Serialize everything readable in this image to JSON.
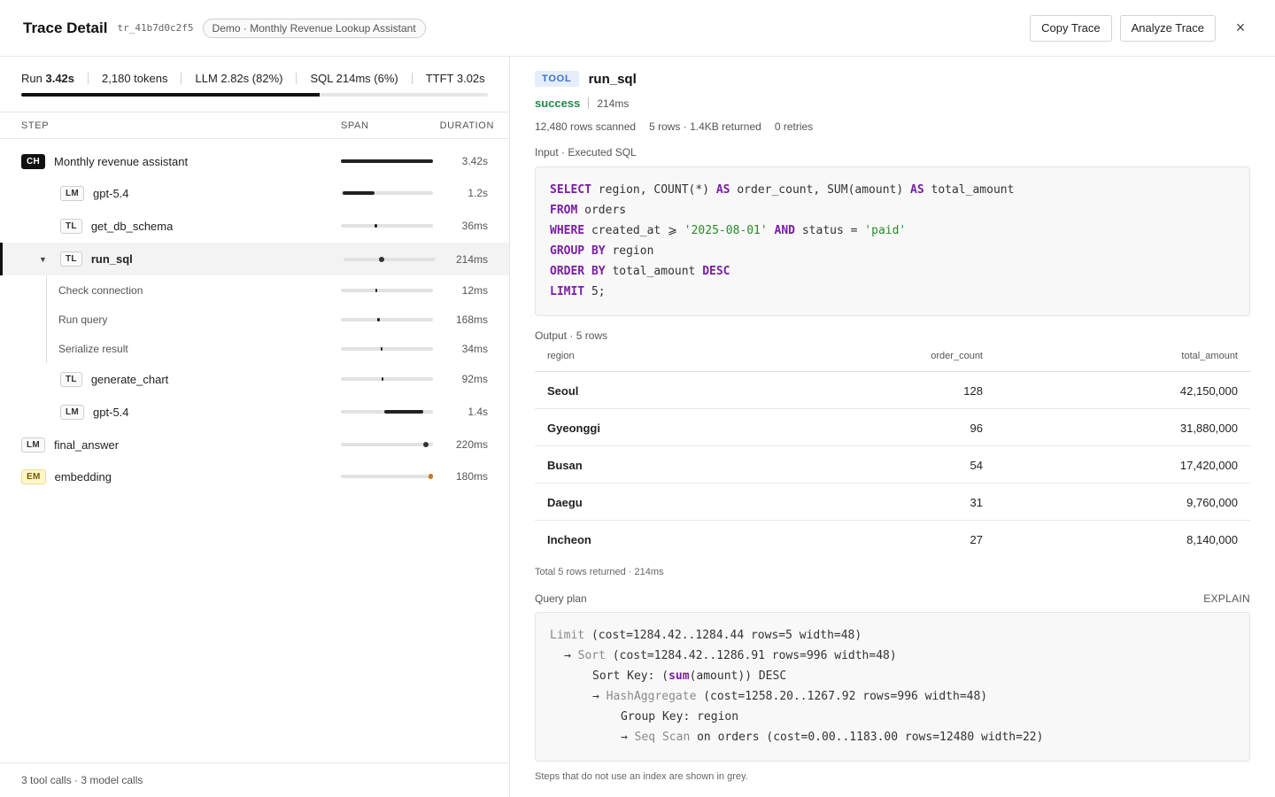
{
  "header": {
    "title": "Trace Detail",
    "trace_id": "tr_41b7d0c2f5",
    "demo_chip": "Demo · Monthly Revenue Lookup Assistant",
    "copy_label": "Copy Trace",
    "analyze_label": "Analyze Trace",
    "close_glyph": "×"
  },
  "stats": {
    "run_label": "Run",
    "run_value": "3.42s",
    "tokens": "2,180 tokens",
    "llm": "LLM 2.82s (82%)",
    "sql": "SQL 214ms (6%)",
    "ttft": "TTFT 3.02s",
    "llm_fraction": 0.64
  },
  "columns": {
    "step": "STEP",
    "span": "SPAN",
    "duration": "DURATION"
  },
  "steps": [
    {
      "badge": "CH",
      "name": "Monthly revenue assistant",
      "duration": "3.42s"
    },
    {
      "badge": "LM",
      "name": "gpt-5.4",
      "duration": "1.2s"
    },
    {
      "badge": "TL",
      "name": "get_db_schema",
      "duration": "36ms"
    },
    {
      "badge": "TL",
      "name": "run_sql",
      "duration": "214ms",
      "caret": "▼"
    },
    {
      "name": "Check connection",
      "duration": "12ms"
    },
    {
      "name": "Run query",
      "duration": "168ms"
    },
    {
      "name": "Serialize result",
      "duration": "34ms"
    },
    {
      "badge": "TL",
      "name": "generate_chart",
      "duration": "92ms"
    },
    {
      "badge": "LM",
      "name": "gpt-5.4",
      "duration": "1.4s"
    },
    {
      "badge": "LM",
      "name": "final_answer",
      "duration": "220ms"
    },
    {
      "badge": "EM",
      "name": "embedding",
      "duration": "180ms"
    }
  ],
  "left_footer": "3 tool calls · 3 model calls",
  "detail": {
    "tag": "TOOL",
    "name": "run_sql",
    "status": "success",
    "duration": "214ms",
    "rows_scanned": "12,480 rows scanned",
    "returned": "5 rows · 1.4KB returned",
    "retries": "0 retries",
    "input_label": "Input · Executed SQL",
    "output_label": "Output · 5 rows",
    "plan_label": "Query plan",
    "explain_label": "EXPLAIN",
    "totals": "Total 5 rows returned · 214ms",
    "footnote": "Steps that do not use an index are shown in grey."
  },
  "sql": {
    "l1_kw1": "SELECT",
    "l1_a": " region, COUNT(*) ",
    "l1_kw2": "AS",
    "l1_b": " order_count, SUM(amount) ",
    "l1_kw3": "AS",
    "l1_c": " total_amount",
    "l2_kw": "FROM",
    "l2_a": " orders",
    "l3_kw": "WHERE",
    "l3_a": " created_at ⩾ ",
    "l3_s1": "'2025-08-01'",
    "l3_kw2": " AND",
    "l3_b": " status = ",
    "l3_s2": "'paid'",
    "l4_kw": "GROUP BY",
    "l4_a": " region",
    "l5_kw": "ORDER BY",
    "l5_a": " total_amount ",
    "l5_kw2": "DESC",
    "l6_kw": "LIMIT",
    "l6_a": " 5;"
  },
  "output": {
    "headers": [
      "region",
      "order_count",
      "total_amount"
    ],
    "rows": [
      [
        "Seoul",
        "128",
        "42,150,000"
      ],
      [
        "Gyeonggi",
        "96",
        "31,880,000"
      ],
      [
        "Busan",
        "54",
        "17,420,000"
      ],
      [
        "Daegu",
        "31",
        "9,760,000"
      ],
      [
        "Incheon",
        "27",
        "8,140,000"
      ]
    ]
  },
  "plan": {
    "p1_node": "Limit",
    "p1_rest": " (cost=1284.42..1284.44 rows=5 width=48)",
    "p2_arrow": "→ ",
    "p2_node": "Sort",
    "p2_rest": " (cost=1284.42..1286.91 rows=996 width=48)",
    "p3_pre": "Sort Key: (",
    "p3_fn": "sum",
    "p3_post": "(amount)) DESC",
    "p4_arrow": "→ ",
    "p4_node": "HashAggregate",
    "p4_rest": " (cost=1258.20..1267.92 rows=996 width=48)",
    "p5": "Group Key: region",
    "p6_arrow": "→ ",
    "p6_node": "Seq Scan",
    "p6_rest": " on orders (cost=0.00..1183.00 rows=12480 width=22)"
  }
}
